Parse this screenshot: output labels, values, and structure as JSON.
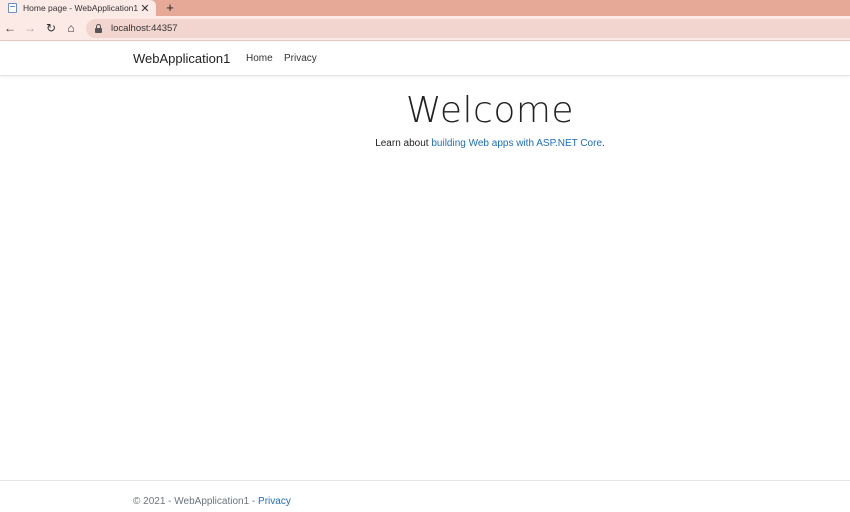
{
  "browser": {
    "tab_title": "Home page - WebApplication1",
    "tab_close": "✕",
    "new_tab": "+",
    "url": "localhost:44357",
    "icons": {
      "back": "←",
      "forward": "→",
      "reload": "↻",
      "home": "⌂"
    }
  },
  "navbar": {
    "brand": "WebApplication1",
    "links": [
      "Home",
      "Privacy"
    ]
  },
  "main": {
    "heading": "Welcome",
    "learn_prefix": "Learn about ",
    "learn_link": "building Web apps with ASP.NET Core",
    "learn_suffix": "."
  },
  "footer": {
    "copyright": "© 2021 - WebApplication1 - ",
    "privacy_link": "Privacy"
  },
  "colors": {
    "tabstrip": "#e6a998",
    "toolbar": "#fbeae6",
    "link": "#1b6ec2"
  }
}
